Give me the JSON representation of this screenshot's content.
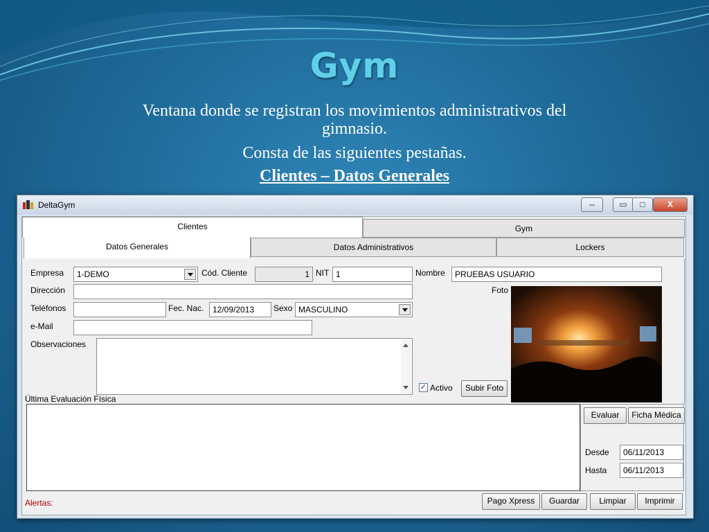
{
  "slide": {
    "title": "Gym",
    "line1a": "Ventana donde se registran los movimientos administrativos del",
    "line1b": "gimnasio.",
    "line2": "Consta de las siguientes pestañas.",
    "line3": "Clientes – Datos Generales"
  },
  "window": {
    "title": "DeltaGym",
    "resize_icon": "⇔",
    "min_icon": "▭",
    "max_icon": "□",
    "close_icon": "X"
  },
  "tabs": {
    "top": [
      "Clientes",
      "Gym"
    ],
    "sub": [
      "Datos Generales",
      "Datos Administrativos",
      "Lockers"
    ]
  },
  "form": {
    "empresa_label": "Empresa",
    "empresa_value": "1-DEMO",
    "cod_label": "Cód. Cliente",
    "cod_value": "1",
    "nit_label": "NIT",
    "nit_value": "1",
    "nombre_label": "Nombre",
    "nombre_value": "PRUEBAS USUARIO",
    "direccion_label": "Dirección",
    "direccion_value": "",
    "telefonos_label": "Teléfonos",
    "telefonos_value": "",
    "fecnac_label": "Fec. Nac.",
    "fecnac_value": "12/09/2013",
    "sexo_label": "Sexo",
    "sexo_value": "MASCULINO",
    "email_label": "e-Mail",
    "email_value": "",
    "obs_label": "Observaciones",
    "obs_value": "",
    "foto_label": "Foto",
    "activo_label": "Activo",
    "activo_check": "✓",
    "subir_foto": "Subir Foto",
    "ultima_eval": "Última Evaluación Física"
  },
  "eval": {
    "evaluar": "Evaluar",
    "ficha": "Ficha Médica",
    "desde_label": "Desde",
    "desde_value": "06/11/2013",
    "hasta_label": "Hasta",
    "hasta_value": "06/11/2013"
  },
  "footer": {
    "alertas": "Alertas:",
    "pago": "Pago Xpress",
    "guardar": "Guardar",
    "limpiar": "Limpiar",
    "imprimir": "Imprimir"
  },
  "colors": {
    "title": "#5fd0e8",
    "alert": "#b00000",
    "background": "#1f6c9c"
  }
}
